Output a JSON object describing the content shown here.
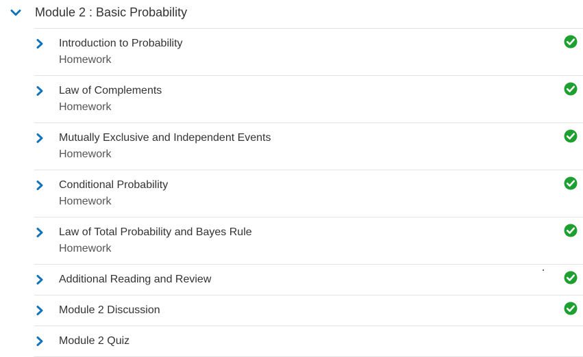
{
  "module": {
    "title": "Module 2 : Basic Probability",
    "expanded": true
  },
  "colors": {
    "accent": "#1173b9",
    "complete": "#1ea031",
    "divider": "#e3e3e3",
    "text": "#333333"
  },
  "items": [
    {
      "title": "Introduction to Probability",
      "subtitle": "Homework",
      "completed": true
    },
    {
      "title": "Law of Complements",
      "subtitle": "Homework",
      "completed": true
    },
    {
      "title": "Mutually Exclusive and Independent Events",
      "subtitle": "Homework",
      "completed": true
    },
    {
      "title": "Conditional Probability",
      "subtitle": "Homework",
      "completed": true
    },
    {
      "title": "Law of Total Probability and Bayes Rule",
      "subtitle": "Homework",
      "completed": true
    },
    {
      "title": "Additional Reading and Review",
      "completed": true
    },
    {
      "title": "Module 2 Discussion",
      "completed": true
    },
    {
      "title": "Module 2 Quiz",
      "completed": false
    }
  ]
}
